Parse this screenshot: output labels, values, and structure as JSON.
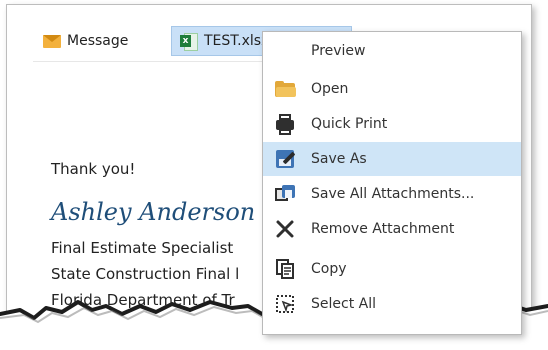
{
  "attachments_bar": {
    "message_tab": {
      "icon": "mail-icon",
      "label": "Message"
    },
    "attachment_tab": {
      "icon": "excel-file-icon",
      "label": "TEST.xlsx"
    }
  },
  "email_body": {
    "thanks": "Thank you!",
    "signature_name": "Ashley Anderson",
    "lines": [
      "Final Estimate Specialist",
      "State Construction Final l",
      "Florida Department of Tr"
    ]
  },
  "context_menu": {
    "items": [
      {
        "name": "preview",
        "label": "Preview",
        "icon": ""
      },
      {
        "name": "open",
        "label": "Open",
        "icon": "folder-icon"
      },
      {
        "name": "quick-print",
        "label": "Quick Print",
        "icon": "printer-icon"
      },
      {
        "name": "save-as",
        "label": "Save As",
        "icon": "save-as-icon",
        "highlighted": true
      },
      {
        "name": "save-all-attachments",
        "label": "Save All Attachments...",
        "icon": "save-all-icon"
      },
      {
        "name": "remove-attachment",
        "label": "Remove Attachment",
        "icon": "remove-icon"
      },
      {
        "name": "copy",
        "label": "Copy",
        "icon": "copy-icon"
      },
      {
        "name": "select-all",
        "label": "Select All",
        "icon": "select-all-icon"
      }
    ]
  },
  "colors": {
    "attachment_highlight": "#c9e0f7",
    "menu_highlight": "#cfe5f7",
    "signature_blue": "#1f4e79",
    "mail_orange": "#f3b13d",
    "excel_green": "#1e7d3b"
  }
}
